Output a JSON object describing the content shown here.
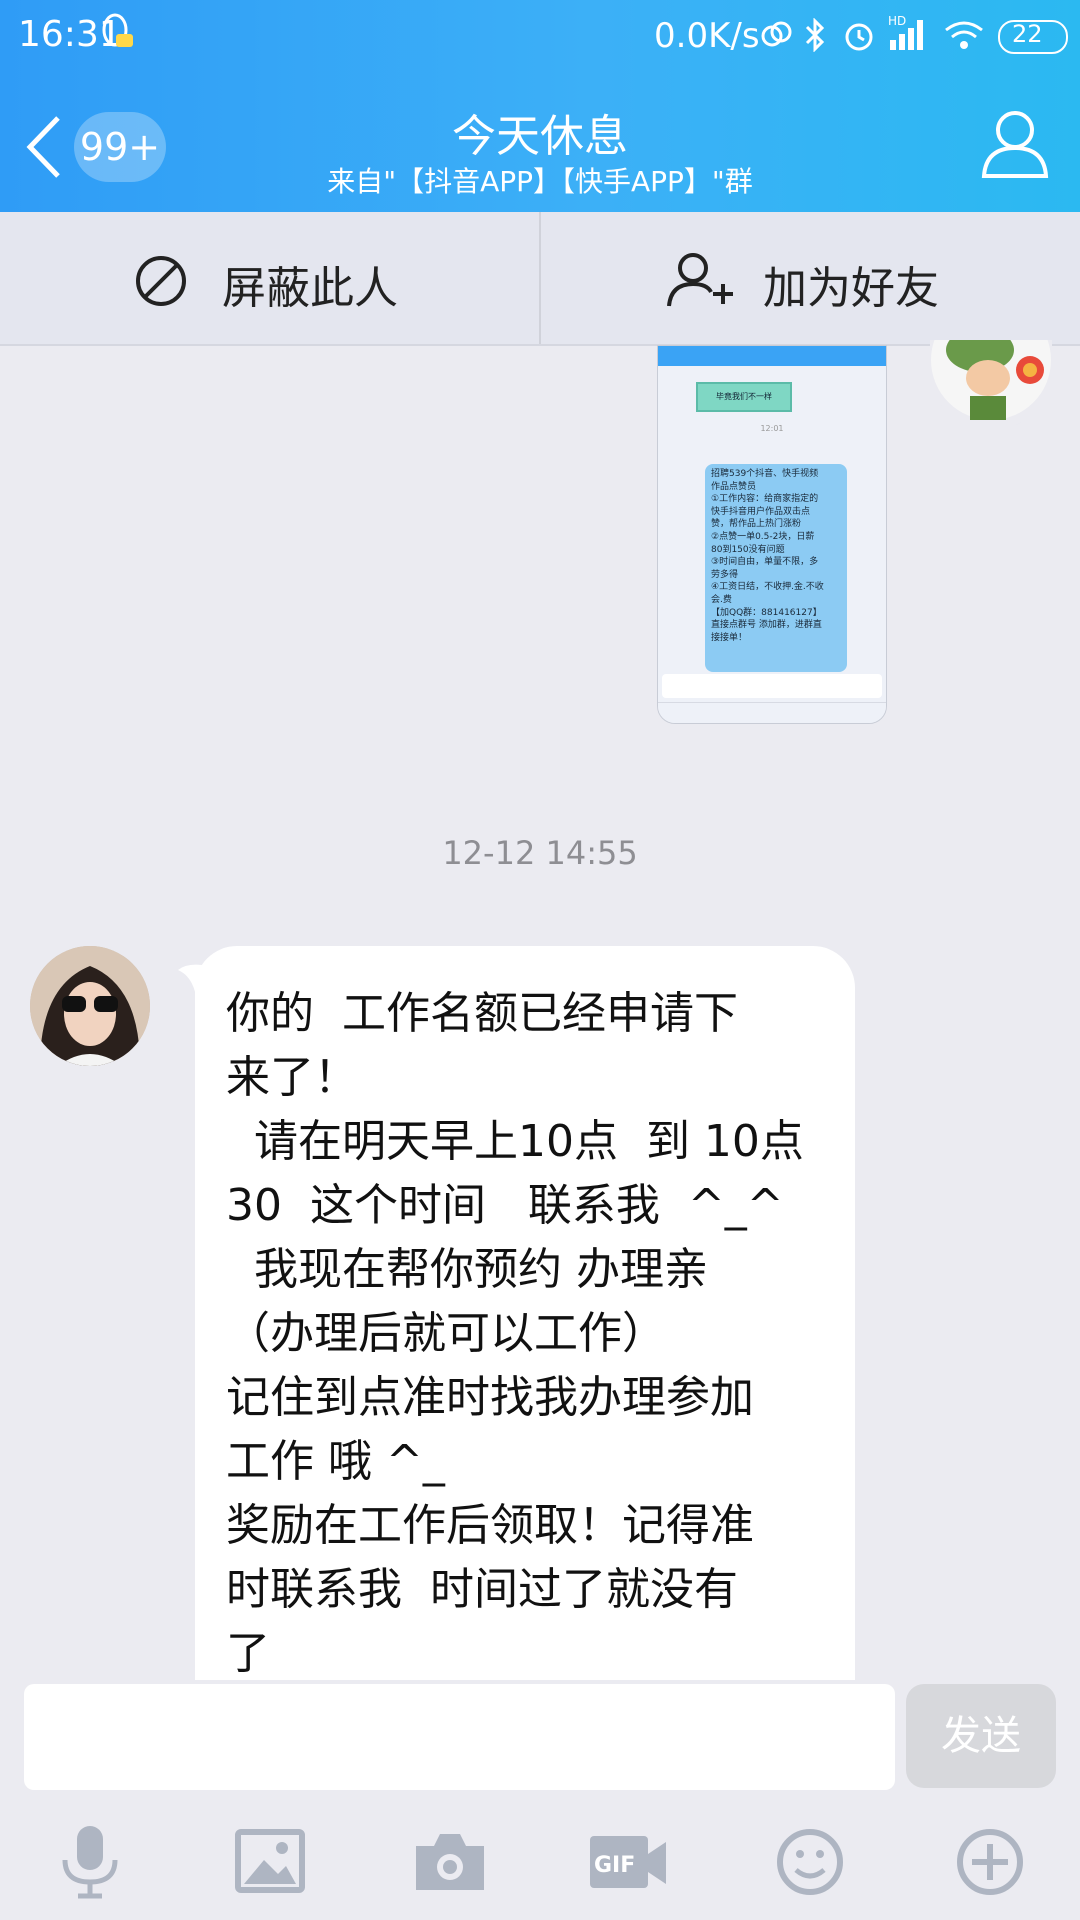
{
  "status": {
    "time": "16:31",
    "net_speed": "0.0K/s",
    "hd": "HD",
    "battery": "22"
  },
  "header": {
    "badge": "99+",
    "title": "今天休息",
    "subtitle": "来自\"【抖音APP】【快手APP】\"群"
  },
  "actions": {
    "block_label": "屏蔽此人",
    "add_label": "加为好友"
  },
  "shared_image": {
    "lines": [
      "毕竟我们不一样",
      "12:01",
      "招聘539个抖音、快手视频",
      "作品点赞员",
      "①工作内容：给商家指定的",
      "快手抖音用户作品双击点",
      "赞，帮作品上热门涨粉",
      "②点赞一单0.5-2块，日薪",
      "80到150没有问题",
      "③时间自由，单量不限，多",
      "劳多得",
      "④工资日结，不收押.金.不收",
      "会.费",
      "【加QQ群：881416127】",
      "直接点群号 添加群，进群直",
      "接接单！"
    ]
  },
  "chat": {
    "timestamp": "12-12 14:55",
    "message": "你的  工作名额已经申请下\n来了！\n  请在明天早上10点  到 10点\n30  这个时间   联系我  ^_^\n  我现在帮你预约 办理亲\n（办理后就可以工作）\n记住到点准时找我办理参加\n工作 哦 ^_\n奖励在工作后领取！记得准\n时联系我  时间过了就没有\n了"
  },
  "input": {
    "placeholder": "",
    "send_label": "发送"
  },
  "toolbar": {
    "gif_label": "GIF"
  },
  "colors": {
    "header_start": "#2f9cf6",
    "header_end": "#2bb9f1",
    "background": "#ebebf1",
    "send_disabled": "#d7d8dc"
  }
}
